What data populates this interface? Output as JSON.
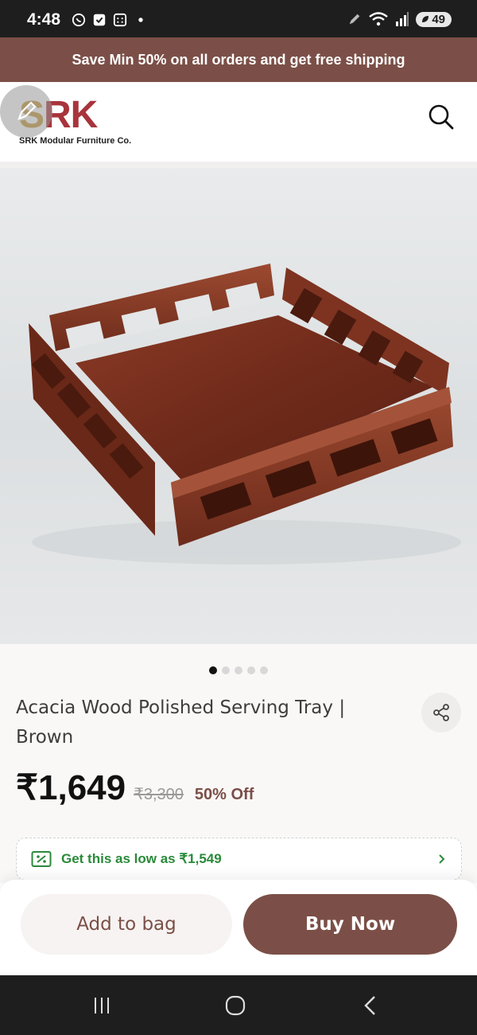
{
  "status_bar": {
    "time": "4:48",
    "battery": "49"
  },
  "promo": {
    "text": "Save Min 50% on all orders and get free shipping"
  },
  "brand": {
    "logo_mark": "SRK",
    "tagline": "SRK Modular Furniture Co."
  },
  "product": {
    "title": "Acacia Wood Polished Serving Tray | Brown",
    "price": "₹1,649",
    "mrp": "₹3,300",
    "discount": "50% Off",
    "image_count": 5,
    "active_image": 1
  },
  "offer": {
    "prefix": "Get this as low as ",
    "amount": "₹1,549"
  },
  "actions": {
    "add_to_bag": "Add to bag",
    "buy_now": "Buy Now"
  },
  "colors": {
    "brand": "#7b4f47",
    "offer_green": "#2a8a3a",
    "logo_gold": "#c79a3a",
    "logo_red": "#a8343c"
  },
  "icons": [
    "whatsapp-icon",
    "check-icon",
    "calendar-icon",
    "pen-icon",
    "wifi-icon",
    "signal-icon",
    "search-icon",
    "share-icon",
    "discount-icon",
    "chevron-right-icon",
    "recents-icon",
    "home-icon",
    "back-icon"
  ]
}
